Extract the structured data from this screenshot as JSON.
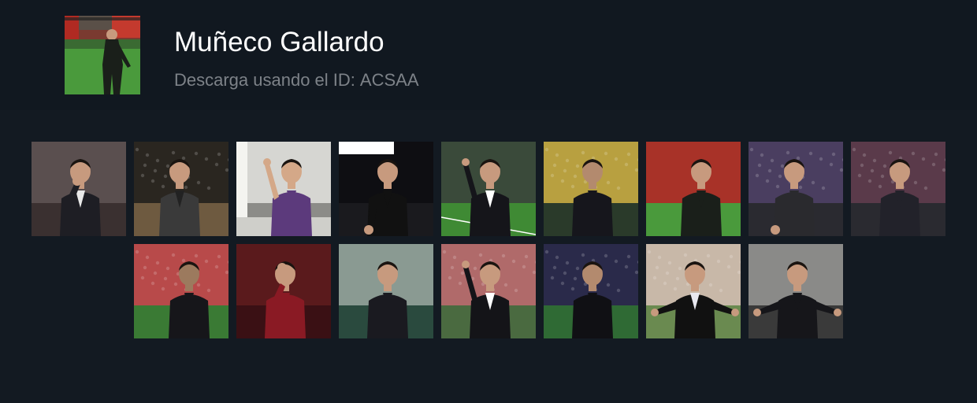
{
  "pack": {
    "title": "Muñeco Gallardo",
    "subtitle_label": "Descarga usando el ID:",
    "pack_id": "ACSAA",
    "avatar_icon": "gallardo-pitch-photo-icon"
  },
  "colors": {
    "header_bg": "#111820",
    "page_bg": "#131a22",
    "title": "#ffffff",
    "subtitle": "#7d8288"
  },
  "stickers": [
    {
      "name": "sticker-hand-on-chin",
      "scene": "stadium-dark",
      "bg": "#5a4f4f",
      "ground": "#3a3030",
      "suit": "#1e1e24",
      "skin": "#c79a7e",
      "shirt": "#e8e8e8",
      "pose": "chin"
    },
    {
      "name": "sticker-hands-on-hips",
      "scene": "night-stadium",
      "bg": "#2a2620",
      "ground": "#6e5a40",
      "suit": "#3a3a3a",
      "skin": "#c79a7e",
      "shirt": "#222",
      "pose": "hips"
    },
    {
      "name": "sticker-waving-booth",
      "scene": "booth",
      "bg": "#d6d6d2",
      "ground": "#8c8c88",
      "suit": "#5c3a7c",
      "skin": "#d4a888",
      "shirt": "#5c3a7c",
      "pose": "wave"
    },
    {
      "name": "sticker-thumbs-up",
      "scene": "press",
      "bg": "#0e0e12",
      "ground": "#1a1a1e",
      "suit": "#111",
      "skin": "#c79a7e",
      "shirt": "#111",
      "pose": "thumb"
    },
    {
      "name": "sticker-fist-pump-pitch",
      "scene": "pitch",
      "bg": "#3a4a3a",
      "ground": "#3f8a34",
      "suit": "#15151a",
      "skin": "#c79a7e",
      "shirt": "#fff",
      "pose": "fist"
    },
    {
      "name": "sticker-smiling-sideline",
      "scene": "sideline",
      "bg": "#b8a040",
      "ground": "#2a3a2a",
      "suit": "#16161c",
      "skin": "#b38a6e",
      "shirt": "#16161c",
      "pose": "smile"
    },
    {
      "name": "sticker-walking-pitch",
      "scene": "pitch-red",
      "bg": "#a83228",
      "ground": "#4a9a3c",
      "suit": "#1a1f1a",
      "skin": "#c79a7e",
      "shirt": "#1a1f1a",
      "pose": "walk"
    },
    {
      "name": "sticker-bench-gesture",
      "scene": "bench",
      "bg": "#4a3e60",
      "ground": "#2a2a30",
      "suit": "#2a2a2e",
      "skin": "#c79a7e",
      "shirt": "#2a2a2e",
      "pose": "point"
    },
    {
      "name": "sticker-bench-standing",
      "scene": "bench2",
      "bg": "#5a3a4a",
      "ground": "#2a2a30",
      "suit": "#22222a",
      "skin": "#c79a7e",
      "shirt": "#22222a",
      "pose": "stand"
    },
    {
      "name": "sticker-walking-away",
      "scene": "stands-red",
      "bg": "#b84a4a",
      "ground": "#3a7a34",
      "suit": "#16161a",
      "skin": "#9c7a5e",
      "shirt": "#16161a",
      "pose": "back"
    },
    {
      "name": "sticker-facepalm",
      "scene": "red-bench",
      "bg": "#5a1a1c",
      "ground": "#3a1014",
      "suit": "#8a1a24",
      "skin": "#c79a7e",
      "shirt": "#8a1a24",
      "pose": "facepalm"
    },
    {
      "name": "sticker-laughing-dugout",
      "scene": "dugout",
      "bg": "#8a9a92",
      "ground": "#2a4a3e",
      "suit": "#1a1a20",
      "skin": "#c79a7e",
      "shirt": "#1a1a20",
      "pose": "laugh"
    },
    {
      "name": "sticker-arm-raised",
      "scene": "crowd",
      "bg": "#b06a6a",
      "ground": "#4a6a40",
      "suit": "#141418",
      "skin": "#c79a7e",
      "shirt": "#fff",
      "pose": "raise"
    },
    {
      "name": "sticker-night-sideline",
      "scene": "night",
      "bg": "#2a2a4a",
      "ground": "#2f6a34",
      "suit": "#101014",
      "skin": "#b38a6e",
      "shirt": "#101014",
      "pose": "stand"
    },
    {
      "name": "sticker-arms-open",
      "scene": "tv",
      "bg": "#c8b8a8",
      "ground": "#6a8a50",
      "suit": "#111",
      "skin": "#c79a7e",
      "shirt": "#e8e8f0",
      "pose": "open"
    },
    {
      "name": "sticker-arms-spread-red",
      "scene": "red-wall",
      "bg": "#8a8a88",
      "ground": "#3a3a3a",
      "suit": "#16161a",
      "skin": "#c79a7e",
      "shirt": "#16161a",
      "pose": "spread"
    }
  ]
}
